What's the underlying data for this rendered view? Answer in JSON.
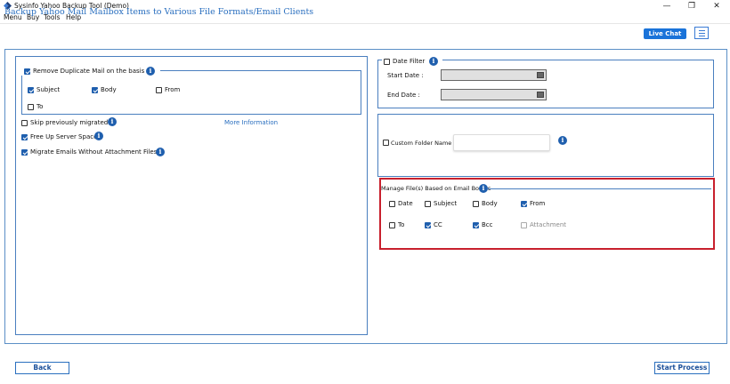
{
  "window": {
    "title": "Sysinfo Yahoo Backup Tool (Demo)",
    "minimize": "—",
    "maximize": "❐",
    "close": "✕"
  },
  "menu": [
    "Menu",
    "Buy",
    "Tools",
    "Help"
  ],
  "header": {
    "title": "Backup Yahoo Mail Mailbox Items to Various File Formats/Email Clients",
    "live_chat": "Live Chat"
  },
  "left": {
    "remove_duplicate": {
      "label": "Remove Duplicate Mail on the basis",
      "checked": true
    },
    "dup_options": [
      {
        "label": "Subject",
        "checked": true
      },
      {
        "label": "Body",
        "checked": true
      },
      {
        "label": "From",
        "checked": false
      },
      {
        "label": "To",
        "checked": false
      }
    ],
    "skip_migrated": {
      "label": "Skip previously migrated",
      "checked": false
    },
    "more_info": "More Information",
    "free_up": {
      "label": "Free Up Server Space",
      "checked": true
    },
    "no_attachment": {
      "label": "Migrate Emails Without Attachment Files",
      "checked": true
    }
  },
  "date_filter": {
    "label": "Date Filter",
    "checked": false,
    "start_label": "Start Date :",
    "end_label": "End Date :",
    "start_value": "",
    "end_value": ""
  },
  "custom_folder": {
    "label": "Custom Folder Name",
    "checked": false,
    "value": ""
  },
  "manage": {
    "label": "Manage File(s) Based on Email Bodies",
    "options": [
      {
        "label": "Date",
        "checked": false
      },
      {
        "label": "Subject",
        "checked": false
      },
      {
        "label": "Body",
        "checked": false
      },
      {
        "label": "From",
        "checked": true
      },
      {
        "label": "To",
        "checked": false
      },
      {
        "label": "CC",
        "checked": true
      },
      {
        "label": "Bcc",
        "checked": true
      },
      {
        "label": "Attachment",
        "checked": false,
        "disabled": true
      }
    ]
  },
  "footer": {
    "back": "Back",
    "start": "Start Process"
  },
  "info_glyph": "i",
  "colors": {
    "accent": "#1f5fae",
    "highlight_border": "#c8202d",
    "title": "#2a6fbf"
  }
}
